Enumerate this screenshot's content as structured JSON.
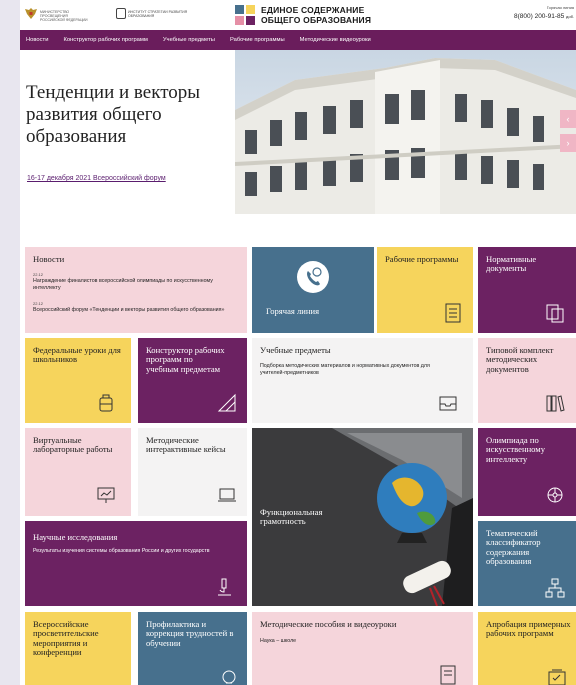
{
  "header": {
    "logo_ministry": "МИНИСТЕРСТВО ПРОСВЕЩЕНИЯ РОССИЙСКОЙ ФЕДЕРАЦИИ",
    "logo_institute": "ИНСТИТУТ СТРАТЕГИИ РАЗВИТИЯ ОБРАЗОВАНИЯ",
    "brand_line1": "ЕДИНОЕ СОДЕРЖАНИЕ",
    "brand_line2": "ОБЩЕГО ОБРАЗОВАНИЯ",
    "hotline_label": "Горячая линия",
    "hotline_phone": "8(800) 200-91-85",
    "hotline_ext": "доб."
  },
  "nav": {
    "items": [
      "Новости",
      "Конструктор рабочих программ",
      "Учебные предметы",
      "Рабочие программы",
      "Методические видеоуроки"
    ]
  },
  "hero": {
    "title": "Тенденции и векторы развития общего образования",
    "link": "16-17 декабря 2021 Всероссийский форум",
    "prev_icon": "‹",
    "next_icon": "›"
  },
  "tiles": {
    "news": {
      "title": "Новости",
      "items": [
        {
          "date": "22.12",
          "text": "Награждение финалистов всероссийской олимпиады по искусственному интеллекту"
        },
        {
          "date": "22.12",
          "text": "Всероссийский форум «Тенденции и векторы развития общего образования»"
        }
      ]
    },
    "hotline": {
      "title": "Горячая линия"
    },
    "work_programs": {
      "title": "Рабочие программы"
    },
    "normative": {
      "title": "Нормативные документы"
    },
    "federal_lessons": {
      "title": "Федеральные уроки для школьников"
    },
    "constructor": {
      "title": "Конструктор рабочих программ по учебным предметам"
    },
    "subjects": {
      "title": "Учебные предметы",
      "text": "Подборка методических материалов и нормативных документов для учителей-предметников"
    },
    "kit": {
      "title": "Типовой комплект методических документов"
    },
    "virtual_labs": {
      "title": "Виртуальные лабораторные работы"
    },
    "cases": {
      "title": "Методические интерактивные кейсы"
    },
    "literacy": {
      "title": "Функциональная грамотность"
    },
    "olympiad": {
      "title": "Олимпиада по искусственному интеллекту"
    },
    "research": {
      "title": "Научные исследования",
      "text": "Результаты изучения системы образования России и других государств"
    },
    "classifier": {
      "title": "Тематический классификатор содержания образования"
    },
    "events": {
      "title": "Всероссийские просветительские мероприятия и конференции"
    },
    "prevention": {
      "title": "Профилактика и коррекция трудностей в обучении"
    },
    "manuals": {
      "title": "Методические пособия и видеоуроки",
      "text": "Наука – школе"
    },
    "approbation": {
      "title": "Апробация примерных рабочих программ"
    }
  },
  "colors": {
    "purple": "#6c2262",
    "pink": "#f5d5db",
    "yellow": "#f6d45c",
    "teal": "#47708d",
    "nav": "#6a1d5c"
  }
}
